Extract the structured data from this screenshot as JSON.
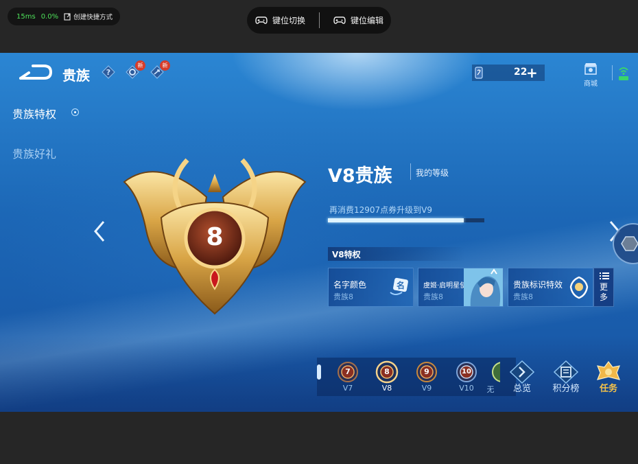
{
  "overlay": {
    "latency": "15ms",
    "loss": "0.0%",
    "shortcut_label": "创建快捷方式",
    "key_switch_label": "键位切换",
    "key_edit_label": "键位编辑"
  },
  "header": {
    "title": "贵族",
    "new_badge_1": "新",
    "new_badge_2": "新",
    "coupon_count": "22",
    "coupon_plus": "+",
    "shop_label": "商城"
  },
  "sidebar": {
    "items": [
      {
        "label": "贵族特权",
        "active": true
      },
      {
        "label": "贵族好礼",
        "active": false
      }
    ]
  },
  "level": {
    "emblem_number": "8",
    "title": "V8贵族",
    "mine_label": "我的等级",
    "upgrade_text": "再消费12907点券升级到V9",
    "progress": 0.87
  },
  "privileges": {
    "heading": "V8特权",
    "cards": [
      {
        "name": "名字颜色",
        "sub": "贵族8"
      },
      {
        "name": "虞姬·启明星使",
        "sub": "贵族8"
      },
      {
        "name": "贵族标识特效",
        "sub": "贵族8"
      }
    ],
    "more_label": "更多"
  },
  "vip_levels": [
    {
      "label": "V7",
      "number": "7",
      "active": false
    },
    {
      "label": "V8",
      "number": "8",
      "active": true
    },
    {
      "label": "V9",
      "number": "9",
      "active": false
    },
    {
      "label": "V10",
      "number": "10",
      "active": false
    },
    {
      "label": "无",
      "number": "",
      "active": false
    }
  ],
  "bottom_nav": [
    {
      "label": "总览",
      "icon": "overview-icon"
    },
    {
      "label": "积分榜",
      "icon": "leaderboard-icon"
    },
    {
      "label": "任务",
      "icon": "task-icon"
    }
  ],
  "colors": {
    "background": "#1c67b6",
    "gold": "#f4c249",
    "new_badge": "#d63c2a",
    "ping_green": "#4ee15a"
  }
}
